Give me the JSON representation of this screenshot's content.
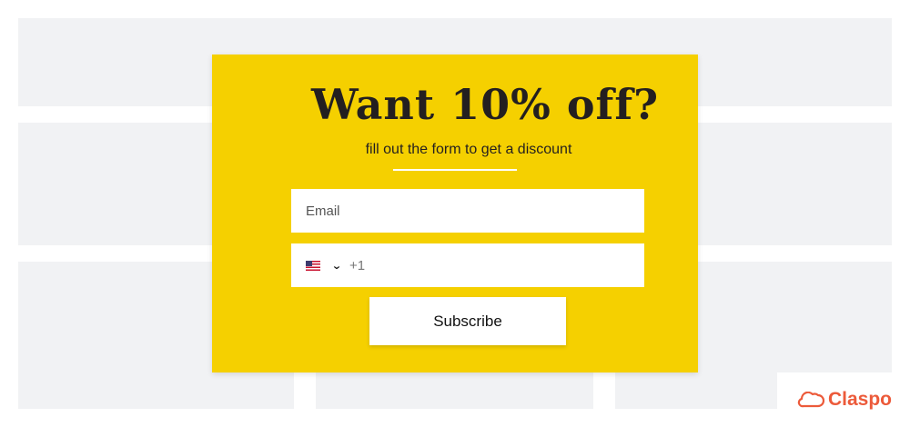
{
  "popup": {
    "title": "Want 10% off?",
    "subtitle": "fill out the form to get a discount",
    "email": {
      "placeholder": "Email",
      "value": ""
    },
    "phone": {
      "country_flag": "us-flag",
      "dial_code": "+1",
      "value": ""
    },
    "subscribe_label": "Subscribe",
    "colors": {
      "background": "#f5d000",
      "text": "#231f20"
    }
  },
  "brand": {
    "name": "Claspo",
    "color": "#ec5a3a",
    "icon": "cloud-icon"
  }
}
